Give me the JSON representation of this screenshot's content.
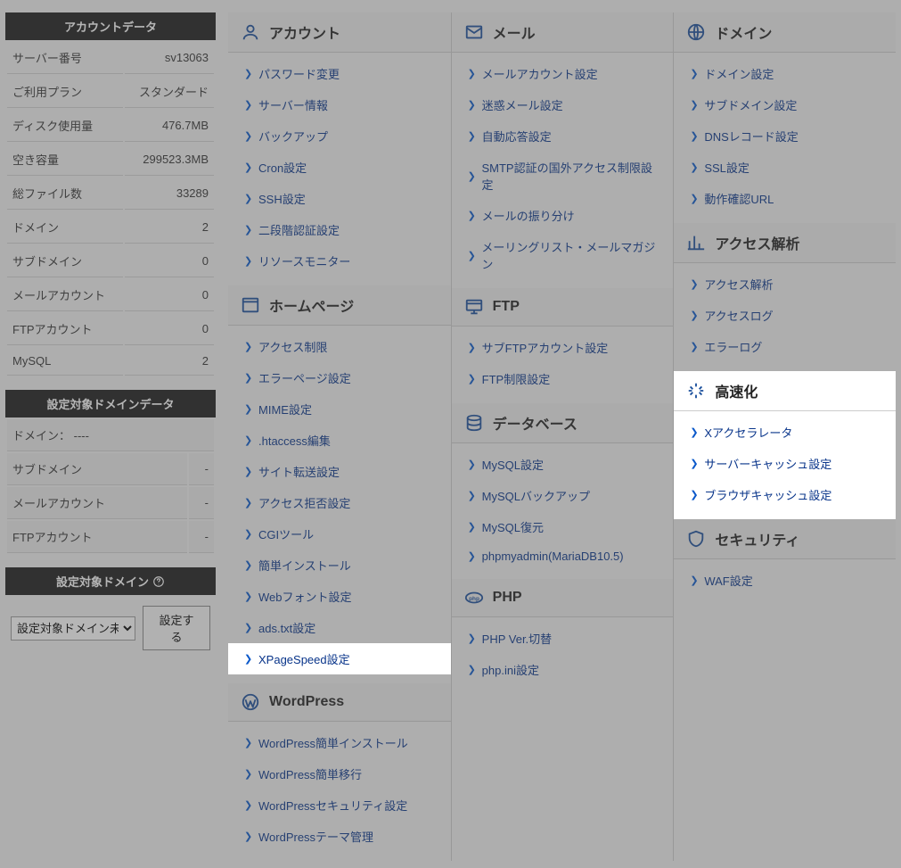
{
  "sidebar": {
    "accountDataTitle": "アカウントデータ",
    "rows": [
      {
        "label": "サーバー番号",
        "value": "sv13063"
      },
      {
        "label": "ご利用プラン",
        "value": "スタンダード"
      },
      {
        "label": "ディスク使用量",
        "value": "476.7MB"
      },
      {
        "label": "空き容量",
        "value": "299523.3MB"
      },
      {
        "label": "総ファイル数",
        "value": "33289"
      },
      {
        "label": "ドメイン",
        "value": "2"
      },
      {
        "label": "サブドメイン",
        "value": "0"
      },
      {
        "label": "メールアカウント",
        "value": "0"
      },
      {
        "label": "FTPアカウント",
        "value": "0"
      },
      {
        "label": "MySQL",
        "value": "2"
      }
    ],
    "domainDataTitle": "設定対象ドメインデータ",
    "domainRows": [
      {
        "label": "ドメイン：",
        "value": "----"
      },
      {
        "label": "サブドメイン",
        "value": "-"
      },
      {
        "label": "メールアカウント",
        "value": "-"
      },
      {
        "label": "FTPアカウント",
        "value": "-"
      }
    ],
    "selectTitle": "設定対象ドメイン",
    "selectPlaceholder": "設定対象ドメイン未",
    "selectBtn": "設定する"
  },
  "sections": {
    "account": {
      "title": "アカウント",
      "items": [
        "パスワード変更",
        "サーバー情報",
        "バックアップ",
        "Cron設定",
        "SSH設定",
        "二段階認証設定",
        "リソースモニター"
      ]
    },
    "mail": {
      "title": "メール",
      "items": [
        "メールアカウント設定",
        "迷惑メール設定",
        "自動応答設定",
        "SMTP認証の国外アクセス制限設定",
        "メールの振り分け",
        "メーリングリスト・メールマガジン"
      ]
    },
    "domain": {
      "title": "ドメイン",
      "items": [
        "ドメイン設定",
        "サブドメイン設定",
        "DNSレコード設定",
        "SSL設定",
        "動作確認URL"
      ]
    },
    "homepage": {
      "title": "ホームページ",
      "items": [
        "アクセス制限",
        "エラーページ設定",
        "MIME設定",
        ".htaccess編集",
        "サイト転送設定",
        "アクセス拒否設定",
        "CGIツール",
        "簡単インストール",
        "Webフォント設定",
        "ads.txt設定",
        "XPageSpeed設定"
      ]
    },
    "ftp": {
      "title": "FTP",
      "items": [
        "サブFTPアカウント設定",
        "FTP制限設定"
      ]
    },
    "access": {
      "title": "アクセス解析",
      "items": [
        "アクセス解析",
        "アクセスログ",
        "エラーログ"
      ]
    },
    "database": {
      "title": "データベース",
      "items": [
        "MySQL設定",
        "MySQLバックアップ",
        "MySQL復元",
        "phpmyadmin(MariaDB10.5)"
      ]
    },
    "speed": {
      "title": "高速化",
      "items": [
        "Xアクセラレータ",
        "サーバーキャッシュ設定",
        "ブラウザキャッシュ設定"
      ]
    },
    "php": {
      "title": "PHP",
      "items": [
        "PHP Ver.切替",
        "php.ini設定"
      ]
    },
    "security": {
      "title": "セキュリティ",
      "items": [
        "WAF設定"
      ]
    },
    "wordpress": {
      "title": "WordPress",
      "items": [
        "WordPress簡単インストール",
        "WordPress簡単移行",
        "WordPressセキュリティ設定",
        "WordPressテーマ管理"
      ]
    }
  },
  "highlights": {
    "speedSection": true,
    "xpagespeedItem": true
  }
}
